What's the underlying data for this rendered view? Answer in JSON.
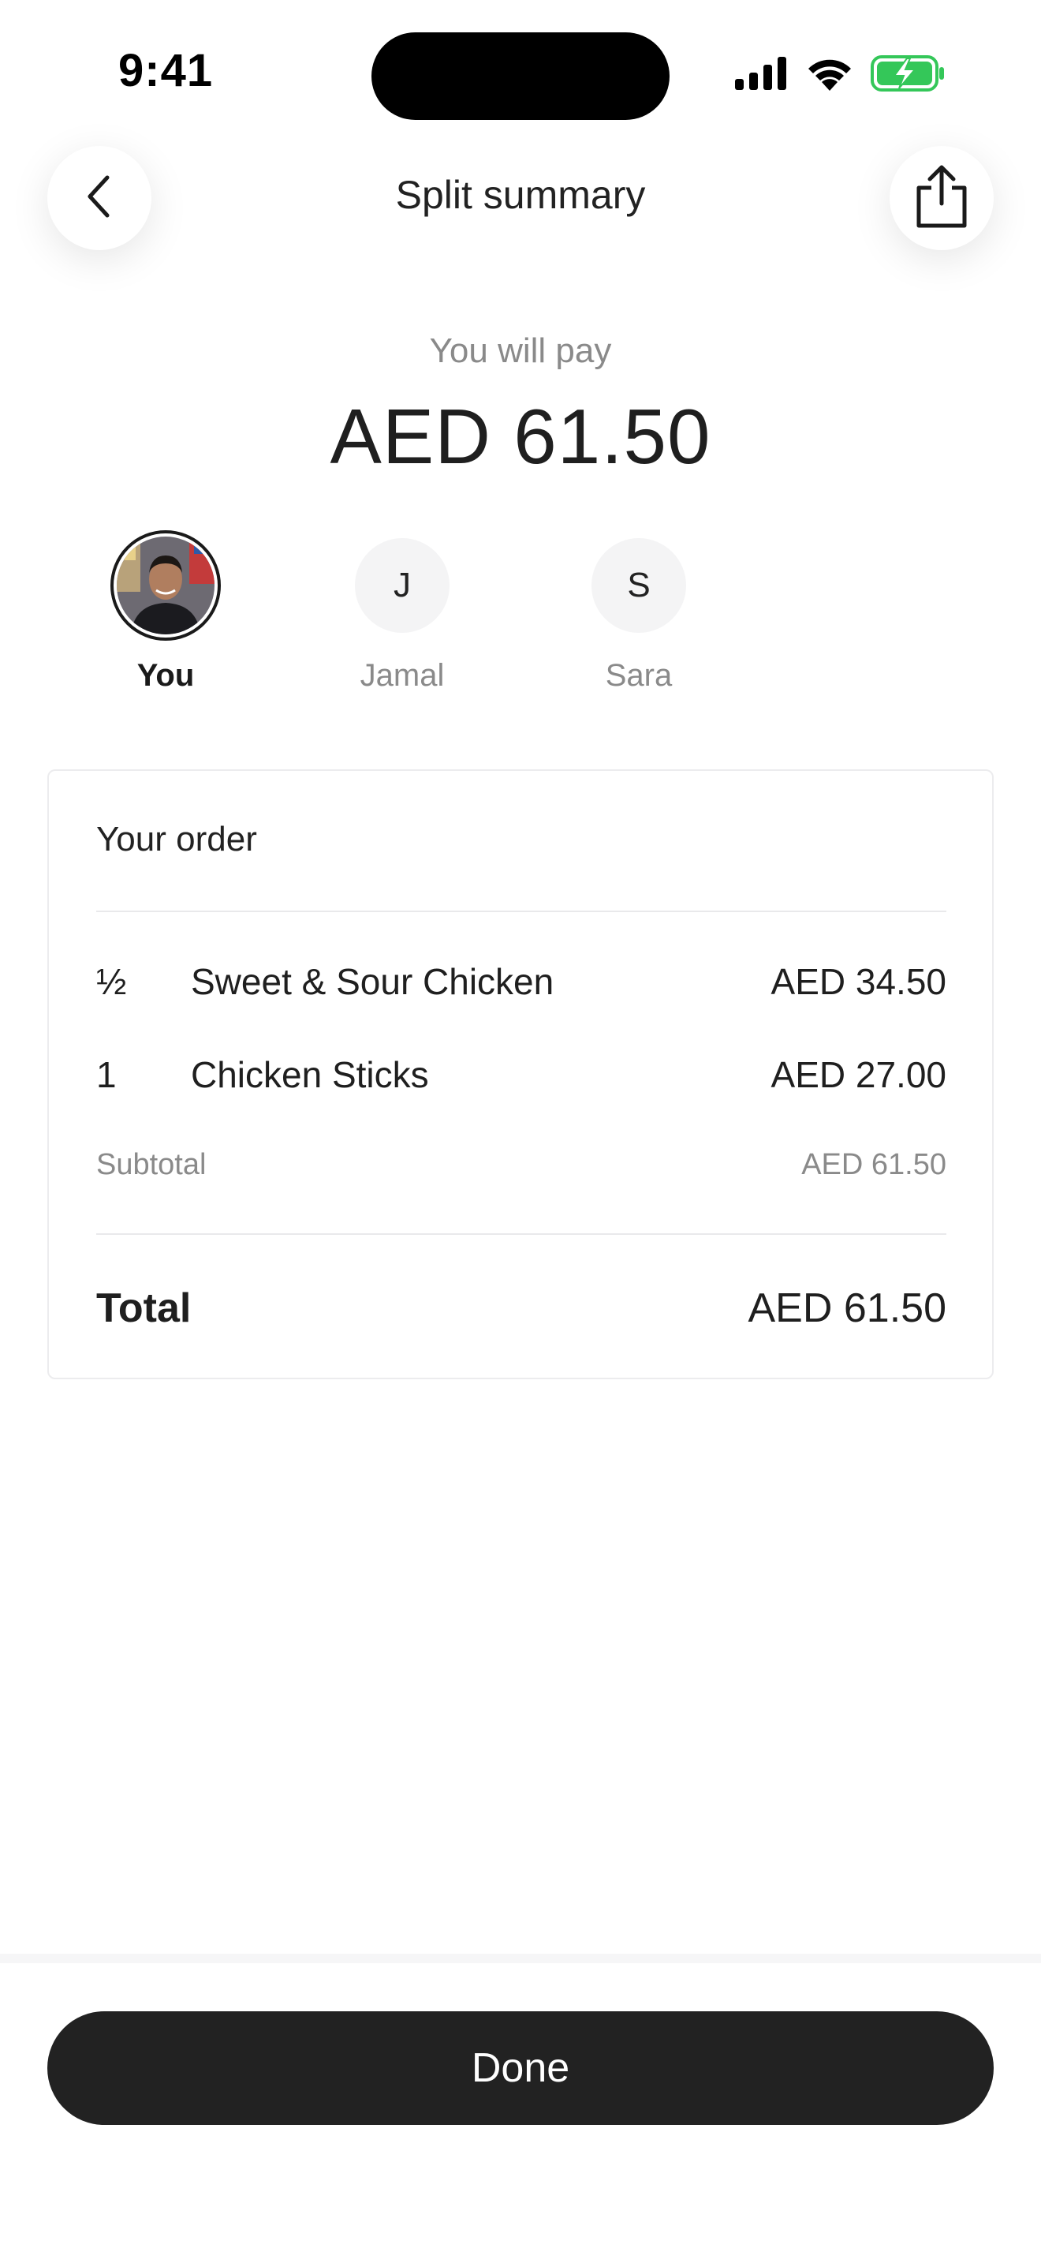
{
  "status_bar": {
    "time": "9:41",
    "icons": [
      "cellular-signal-icon",
      "wifi-icon",
      "battery-charging-icon"
    ],
    "battery_color": "#34c759"
  },
  "header": {
    "title": "Split summary",
    "back_icon": "chevron-left-icon",
    "share_icon": "share-icon"
  },
  "summary": {
    "label": "You will pay",
    "amount": "AED 61.50"
  },
  "participants": [
    {
      "name": "You",
      "initial": "",
      "selected": true
    },
    {
      "name": "Jamal",
      "initial": "J",
      "selected": false
    },
    {
      "name": "Sara",
      "initial": "S",
      "selected": false
    }
  ],
  "order": {
    "title": "Your order",
    "items": [
      {
        "qty": "½",
        "name": "Sweet & Sour Chicken",
        "price": "AED 34.50"
      },
      {
        "qty": "1",
        "name": "Chicken Sticks",
        "price": "AED 27.00"
      }
    ],
    "subtotal_label": "Subtotal",
    "subtotal_value": "AED 61.50",
    "total_label": "Total",
    "total_value": "AED 61.50"
  },
  "footer": {
    "done_label": "Done",
    "button_color": "#222222"
  }
}
